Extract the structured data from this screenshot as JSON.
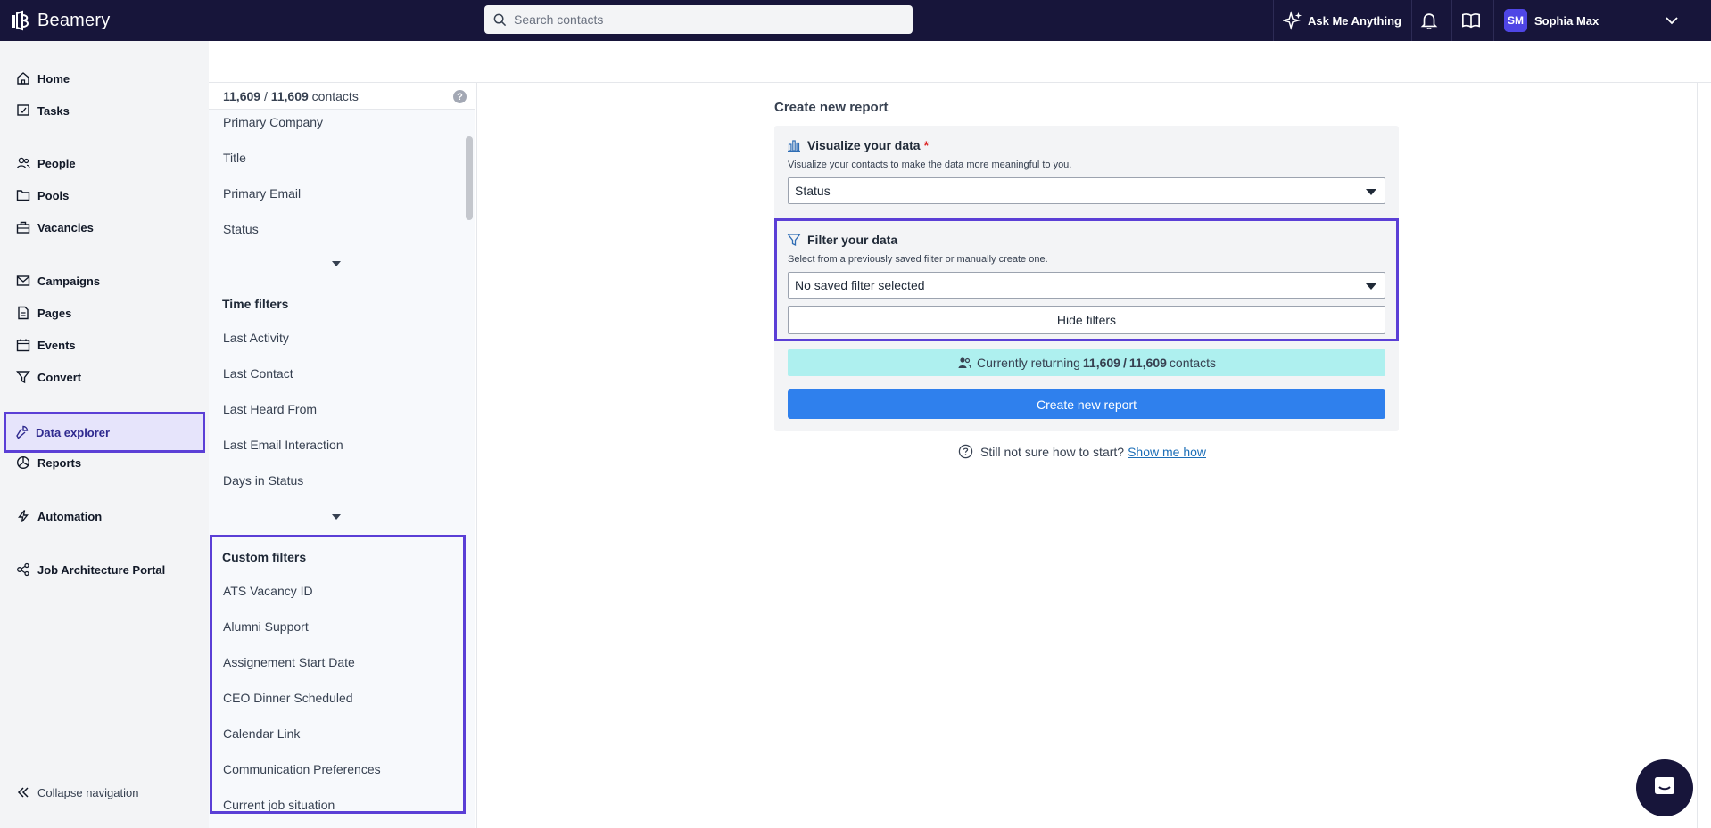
{
  "app": {
    "logo_text": "Beamery",
    "search_placeholder": "Search contacts",
    "ask_label": "Ask Me Anything",
    "user_initials": "SM",
    "user_name": "Sophia Max"
  },
  "nav": {
    "items": [
      {
        "label": "Home",
        "icon": "home-icon"
      },
      {
        "label": "Tasks",
        "icon": "tasks-icon"
      },
      {
        "label": "People",
        "icon": "people-icon"
      },
      {
        "label": "Pools",
        "icon": "folder-icon"
      },
      {
        "label": "Vacancies",
        "icon": "briefcase-icon"
      },
      {
        "label": "Campaigns",
        "icon": "mail-icon"
      },
      {
        "label": "Pages",
        "icon": "page-icon"
      },
      {
        "label": "Events",
        "icon": "calendar-icon"
      },
      {
        "label": "Convert",
        "icon": "funnel-icon"
      },
      {
        "label": "Data explorer",
        "icon": "data-explorer-icon",
        "active": true
      },
      {
        "label": "Reports",
        "icon": "reports-icon"
      },
      {
        "label": "Automation",
        "icon": "lightning-icon"
      },
      {
        "label": "Job Architecture Portal",
        "icon": "nodes-icon"
      }
    ],
    "collapse_label": "Collapse navigation"
  },
  "filters": {
    "count_shown": "11,609",
    "count_sep": " / ",
    "count_total": "11,609",
    "count_suffix": " contacts",
    "help": "?",
    "primary_items": [
      "Primary Company",
      "Title",
      "Primary Email",
      "Status"
    ],
    "time_heading": "Time filters",
    "time_items": [
      "Last Activity",
      "Last Contact",
      "Last Heard From",
      "Last Email Interaction",
      "Days in Status"
    ],
    "custom_heading": "Custom filters",
    "custom_items": [
      "ATS Vacancy ID",
      "Alumni Support",
      "Assignement Start Date",
      "CEO Dinner Scheduled",
      "Calendar Link",
      "Communication Preferences",
      "Current job situation"
    ]
  },
  "report": {
    "title": "Create new report",
    "visualize_title": "Visualize your data",
    "required_mark": "*",
    "visualize_sub": "Visualize your contacts to make the data more meaningful to you.",
    "visualize_value": "Status",
    "filter_title": "Filter your data",
    "filter_sub": "Select from a previously saved filter or manually create one.",
    "filter_value": "No saved filter selected",
    "hide_filters_label": "Hide filters",
    "returning_prefix": "Currently returning",
    "returning_shown": "11,609",
    "returning_sep": "/",
    "returning_total": "11,609",
    "returning_suffix": "contacts",
    "create_label": "Create new report",
    "hint_text": "Still not sure how to start?",
    "hint_link": "Show me how"
  },
  "colors": {
    "topbar": "#17153a",
    "accent_outline": "#5b3fd6",
    "primary_button": "#2f80ed",
    "returning_bg": "#aef0ef"
  }
}
